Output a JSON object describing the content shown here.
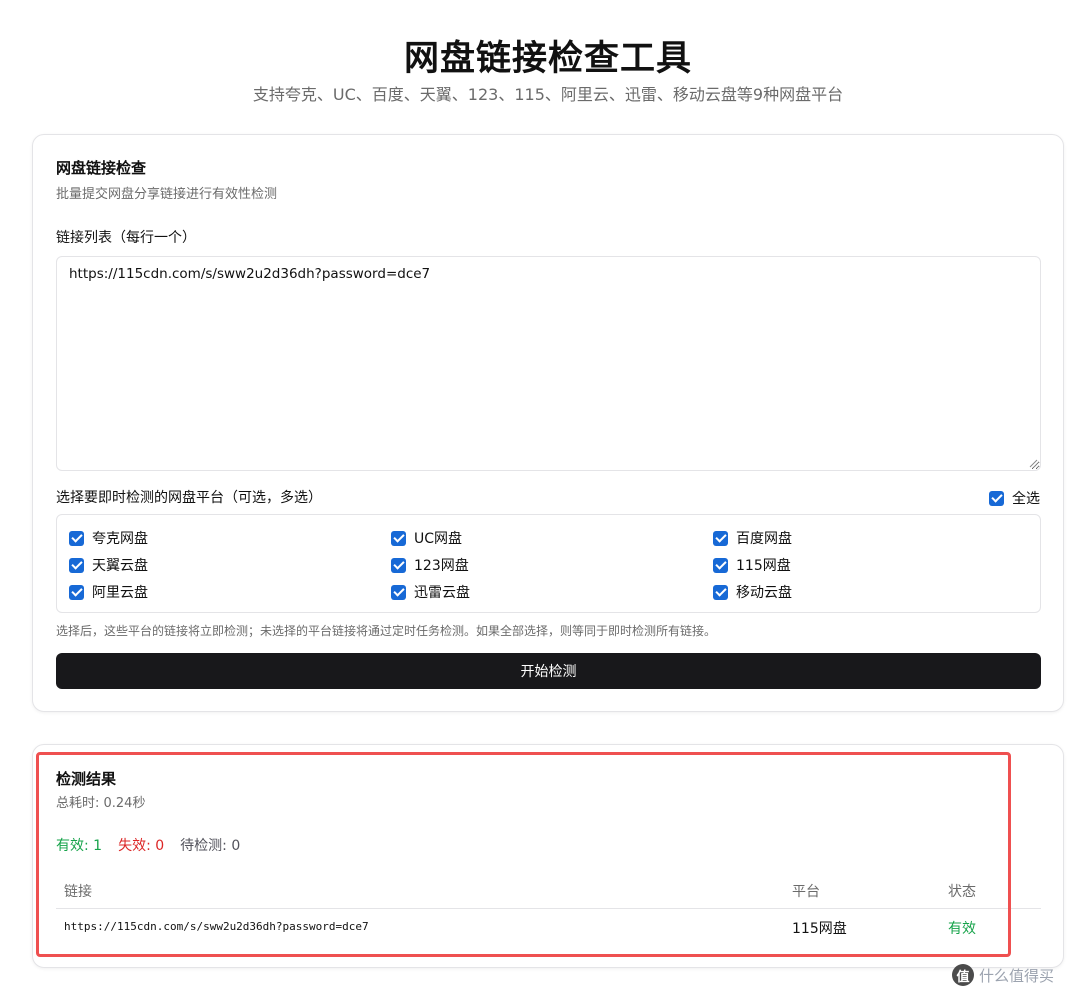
{
  "header": {
    "title": "网盘链接检查工具",
    "subtitle": "支持夸克、UC、百度、天翼、123、115、阿里云、迅雷、移动云盘等9种网盘平台"
  },
  "check_form": {
    "title": "网盘链接检查",
    "description": "批量提交网盘分享链接进行有效性检测",
    "links_label": "链接列表（每行一个）",
    "links_value": "https://115cdn.com/s/sww2u2d36dh?password=dce7",
    "platform_label": "选择要即时检测的网盘平台（可选，多选）",
    "select_all_label": "全选",
    "select_all_checked": true,
    "platforms": [
      {
        "label": "夸克网盘",
        "checked": true
      },
      {
        "label": "UC网盘",
        "checked": true
      },
      {
        "label": "百度网盘",
        "checked": true
      },
      {
        "label": "天翼云盘",
        "checked": true
      },
      {
        "label": "123网盘",
        "checked": true
      },
      {
        "label": "115网盘",
        "checked": true
      },
      {
        "label": "阿里云盘",
        "checked": true
      },
      {
        "label": "迅雷云盘",
        "checked": true
      },
      {
        "label": "移动云盘",
        "checked": true
      }
    ],
    "hint": "选择后，这些平台的链接将立即检测；未选择的平台链接将通过定时任务检测。如果全部选择，则等同于即时检测所有链接。",
    "start_button": "开始检测"
  },
  "results": {
    "title": "检测结果",
    "elapsed": "总耗时: 0.24秒",
    "valid": "有效: 1",
    "invalid": "失效: 0",
    "pending": "待检测: 0",
    "columns": {
      "link": "链接",
      "platform": "平台",
      "status": "状态"
    },
    "rows": [
      {
        "link": "https://115cdn.com/s/sww2u2d36dh?password=dce7",
        "platform": "115网盘",
        "status": "有效"
      }
    ]
  },
  "watermark": {
    "logo": "值",
    "text": "什么值得买"
  },
  "colors": {
    "accent": "#1769d6",
    "valid": "#16a34a",
    "invalid": "#dc2626",
    "highlight": "#ef5050",
    "button": "#18181b"
  }
}
